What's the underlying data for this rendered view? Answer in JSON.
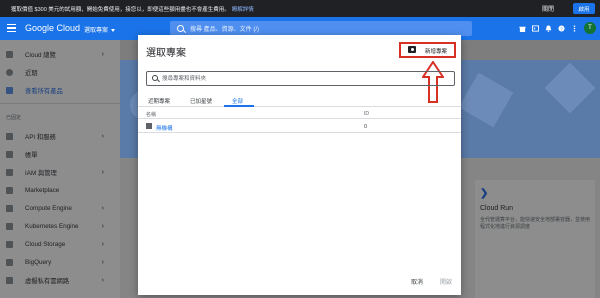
{
  "promo": {
    "text": "獲取價值 $300 美元的試用額，開始免費使用，接您以，即便這些額用盡也不會產生費用。",
    "link": "瞭解詳情",
    "dismiss": "關閉",
    "activate": "啟用"
  },
  "header": {
    "brand": "Google Cloud",
    "project_selector": "選取專案",
    "search_placeholder": "搜尋 產品、資源、文件 (/)",
    "avatar_letter": "T"
  },
  "sidebar": {
    "items": [
      {
        "label": "Cloud 總覽",
        "chevron": "›"
      },
      {
        "label": "近期",
        "chevron": ""
      },
      {
        "label": "查看所有產品",
        "chevron": ""
      }
    ],
    "section_label": "已固定",
    "pinned": [
      {
        "label": "API 和服務",
        "chevron": "›"
      },
      {
        "label": "帳單",
        "chevron": ""
      },
      {
        "label": "IAM 與管理",
        "chevron": "›"
      },
      {
        "label": "Marketplace",
        "chevron": ""
      },
      {
        "label": "Compute Engine",
        "chevron": "›"
      },
      {
        "label": "Kubernetes Engine",
        "chevron": "›"
      },
      {
        "label": "Cloud Storage",
        "chevron": "›"
      },
      {
        "label": "BigQuery",
        "chevron": "›"
      },
      {
        "label": "虛擬私有雲網路",
        "chevron": "›"
      }
    ]
  },
  "card": {
    "title": "Cloud Run",
    "description": "全代管運算平台，能快速安全地部署容器，並使用程式化地進行資源調度"
  },
  "dialog": {
    "title": "選取專案",
    "new_project": "新增專案",
    "search_placeholder": "搜尋專案和資料夾",
    "tabs": [
      "近期專案",
      "已加星號",
      "全部"
    ],
    "active_tab": "全部",
    "columns": {
      "name": "名稱",
      "id": "ID"
    },
    "rows": [
      {
        "name": "無機構",
        "id": "0"
      }
    ],
    "cancel": "取消",
    "open": "開啟"
  },
  "colors": {
    "accent": "#1a73e8",
    "highlight": "#d93025"
  }
}
